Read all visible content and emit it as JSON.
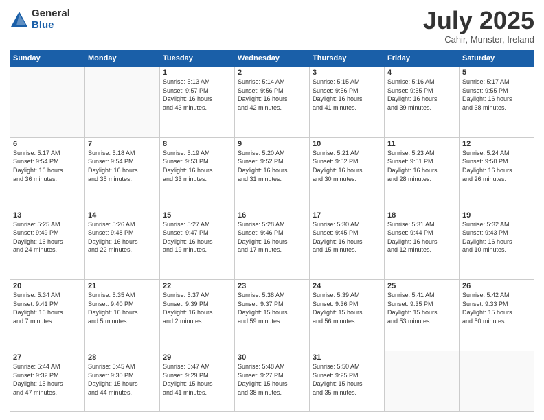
{
  "logo": {
    "general": "General",
    "blue": "Blue"
  },
  "title": "July 2025",
  "location": "Cahir, Munster, Ireland",
  "days_header": [
    "Sunday",
    "Monday",
    "Tuesday",
    "Wednesday",
    "Thursday",
    "Friday",
    "Saturday"
  ],
  "weeks": [
    [
      {
        "day": "",
        "info": ""
      },
      {
        "day": "",
        "info": ""
      },
      {
        "day": "1",
        "info": "Sunrise: 5:13 AM\nSunset: 9:57 PM\nDaylight: 16 hours\nand 43 minutes."
      },
      {
        "day": "2",
        "info": "Sunrise: 5:14 AM\nSunset: 9:56 PM\nDaylight: 16 hours\nand 42 minutes."
      },
      {
        "day": "3",
        "info": "Sunrise: 5:15 AM\nSunset: 9:56 PM\nDaylight: 16 hours\nand 41 minutes."
      },
      {
        "day": "4",
        "info": "Sunrise: 5:16 AM\nSunset: 9:55 PM\nDaylight: 16 hours\nand 39 minutes."
      },
      {
        "day": "5",
        "info": "Sunrise: 5:17 AM\nSunset: 9:55 PM\nDaylight: 16 hours\nand 38 minutes."
      }
    ],
    [
      {
        "day": "6",
        "info": "Sunrise: 5:17 AM\nSunset: 9:54 PM\nDaylight: 16 hours\nand 36 minutes."
      },
      {
        "day": "7",
        "info": "Sunrise: 5:18 AM\nSunset: 9:54 PM\nDaylight: 16 hours\nand 35 minutes."
      },
      {
        "day": "8",
        "info": "Sunrise: 5:19 AM\nSunset: 9:53 PM\nDaylight: 16 hours\nand 33 minutes."
      },
      {
        "day": "9",
        "info": "Sunrise: 5:20 AM\nSunset: 9:52 PM\nDaylight: 16 hours\nand 31 minutes."
      },
      {
        "day": "10",
        "info": "Sunrise: 5:21 AM\nSunset: 9:52 PM\nDaylight: 16 hours\nand 30 minutes."
      },
      {
        "day": "11",
        "info": "Sunrise: 5:23 AM\nSunset: 9:51 PM\nDaylight: 16 hours\nand 28 minutes."
      },
      {
        "day": "12",
        "info": "Sunrise: 5:24 AM\nSunset: 9:50 PM\nDaylight: 16 hours\nand 26 minutes."
      }
    ],
    [
      {
        "day": "13",
        "info": "Sunrise: 5:25 AM\nSunset: 9:49 PM\nDaylight: 16 hours\nand 24 minutes."
      },
      {
        "day": "14",
        "info": "Sunrise: 5:26 AM\nSunset: 9:48 PM\nDaylight: 16 hours\nand 22 minutes."
      },
      {
        "day": "15",
        "info": "Sunrise: 5:27 AM\nSunset: 9:47 PM\nDaylight: 16 hours\nand 19 minutes."
      },
      {
        "day": "16",
        "info": "Sunrise: 5:28 AM\nSunset: 9:46 PM\nDaylight: 16 hours\nand 17 minutes."
      },
      {
        "day": "17",
        "info": "Sunrise: 5:30 AM\nSunset: 9:45 PM\nDaylight: 16 hours\nand 15 minutes."
      },
      {
        "day": "18",
        "info": "Sunrise: 5:31 AM\nSunset: 9:44 PM\nDaylight: 16 hours\nand 12 minutes."
      },
      {
        "day": "19",
        "info": "Sunrise: 5:32 AM\nSunset: 9:43 PM\nDaylight: 16 hours\nand 10 minutes."
      }
    ],
    [
      {
        "day": "20",
        "info": "Sunrise: 5:34 AM\nSunset: 9:41 PM\nDaylight: 16 hours\nand 7 minutes."
      },
      {
        "day": "21",
        "info": "Sunrise: 5:35 AM\nSunset: 9:40 PM\nDaylight: 16 hours\nand 5 minutes."
      },
      {
        "day": "22",
        "info": "Sunrise: 5:37 AM\nSunset: 9:39 PM\nDaylight: 16 hours\nand 2 minutes."
      },
      {
        "day": "23",
        "info": "Sunrise: 5:38 AM\nSunset: 9:37 PM\nDaylight: 15 hours\nand 59 minutes."
      },
      {
        "day": "24",
        "info": "Sunrise: 5:39 AM\nSunset: 9:36 PM\nDaylight: 15 hours\nand 56 minutes."
      },
      {
        "day": "25",
        "info": "Sunrise: 5:41 AM\nSunset: 9:35 PM\nDaylight: 15 hours\nand 53 minutes."
      },
      {
        "day": "26",
        "info": "Sunrise: 5:42 AM\nSunset: 9:33 PM\nDaylight: 15 hours\nand 50 minutes."
      }
    ],
    [
      {
        "day": "27",
        "info": "Sunrise: 5:44 AM\nSunset: 9:32 PM\nDaylight: 15 hours\nand 47 minutes."
      },
      {
        "day": "28",
        "info": "Sunrise: 5:45 AM\nSunset: 9:30 PM\nDaylight: 15 hours\nand 44 minutes."
      },
      {
        "day": "29",
        "info": "Sunrise: 5:47 AM\nSunset: 9:29 PM\nDaylight: 15 hours\nand 41 minutes."
      },
      {
        "day": "30",
        "info": "Sunrise: 5:48 AM\nSunset: 9:27 PM\nDaylight: 15 hours\nand 38 minutes."
      },
      {
        "day": "31",
        "info": "Sunrise: 5:50 AM\nSunset: 9:25 PM\nDaylight: 15 hours\nand 35 minutes."
      },
      {
        "day": "",
        "info": ""
      },
      {
        "day": "",
        "info": ""
      }
    ]
  ]
}
